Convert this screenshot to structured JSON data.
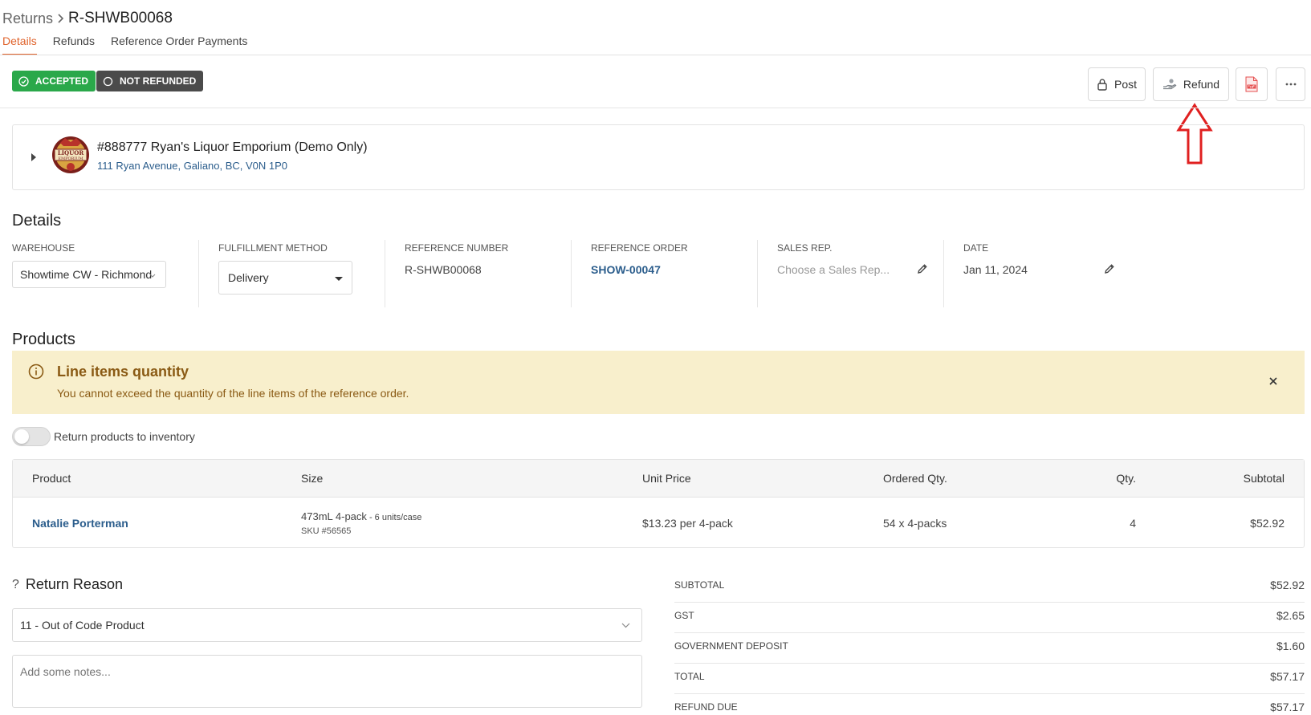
{
  "header": {
    "breadcrumb_parent": "Returns",
    "breadcrumb_current": "R-SHWB00068"
  },
  "tabs": [
    {
      "label": "Details",
      "active": true
    },
    {
      "label": "Refunds",
      "active": false
    },
    {
      "label": "Reference Order Payments",
      "active": false
    }
  ],
  "status": {
    "accepted": "ACCEPTED",
    "not_refunded": "NOT REFUNDED",
    "accepted_color": "#2aa84a",
    "not_refunded_color": "#4b4b4b"
  },
  "actions": {
    "post_label": "Post",
    "refund_label": "Refund",
    "pdf_icon": "pdf-icon",
    "more_icon": "ellipsis-icon"
  },
  "annotation": {
    "arrow_color": "#e02020"
  },
  "customer": {
    "name": "#888777 Ryan's Liquor Emporium (Demo Only)",
    "address": "111 Ryan Avenue, Galiano, BC, V0N 1P0",
    "logo_text_top": "LIQUOR",
    "logo_text_bottom": "EMPORIUM"
  },
  "details": {
    "title": "Details",
    "warehouse_label": "WAREHOUSE",
    "warehouse_value": "Showtime CW - Richmond",
    "fulfillment_label": "FULFILLMENT METHOD",
    "fulfillment_value": "Delivery",
    "reference_number_label": "REFERENCE NUMBER",
    "reference_number_value": "R-SHWB00068",
    "reference_order_label": "REFERENCE ORDER",
    "reference_order_value": "SHOW-00047",
    "sales_rep_label": "SALES REP.",
    "sales_rep_placeholder": "Choose a Sales Rep...",
    "date_label": "DATE",
    "date_value": "Jan 11, 2024"
  },
  "products": {
    "title": "Products",
    "alert_title": "Line items quantity",
    "alert_text": "You cannot exceed the quantity of the line items of the reference order.",
    "toggle_label": "Return products to inventory",
    "toggle_on": false,
    "columns": [
      "Product",
      "Size",
      "Unit Price",
      "Ordered Qty.",
      "Qty.",
      "Subtotal"
    ],
    "rows": [
      {
        "product": "Natalie Porterman",
        "size": "473mL 4-pack",
        "size_units": " - 6 units/case",
        "sku": "SKU #56565",
        "unit_price": "$13.23 per 4-pack",
        "ordered_qty": "54 x 4-packs",
        "qty": "4",
        "subtotal": "$52.92"
      }
    ]
  },
  "return_reason": {
    "icon": "?",
    "title": "Return Reason",
    "selected": "11 - Out of Code Product",
    "notes_placeholder": "Add some notes..."
  },
  "totals": [
    {
      "label": "SUBTOTAL",
      "value": "$52.92"
    },
    {
      "label": "GST",
      "value": "$2.65"
    },
    {
      "label": "GOVERNMENT DEPOSIT",
      "value": "$1.60"
    },
    {
      "label": "TOTAL",
      "value": "$57.17"
    },
    {
      "label": "REFUND DUE",
      "value": "$57.17"
    }
  ]
}
